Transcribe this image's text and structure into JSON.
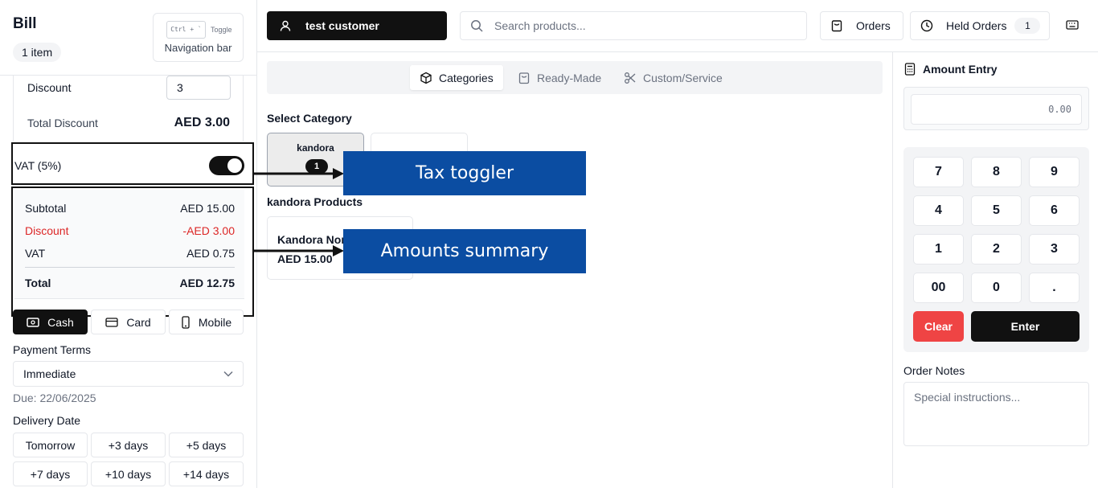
{
  "bill": {
    "title": "Bill",
    "item_count": "1 item",
    "nav_toggle": {
      "shortcut": "Ctrl + `",
      "word": "Toggle",
      "label": "Navigation bar"
    },
    "discount_label": "Discount",
    "discount_value": "3",
    "total_discount_label": "Total Discount",
    "total_discount_value": "AED 3.00",
    "vat_label": "VAT (5%)",
    "vat_enabled": true,
    "summary": {
      "subtotal_label": "Subtotal",
      "subtotal_value": "AED 15.00",
      "discount_label": "Discount",
      "discount_value": "-AED 3.00",
      "vat_label": "VAT",
      "vat_value": "AED 0.75",
      "total_label": "Total",
      "total_value": "AED 12.75"
    },
    "payment_methods": [
      "Cash",
      "Card",
      "Mobile"
    ],
    "selected_payment": "Cash",
    "payment_terms_label": "Payment Terms",
    "payment_terms_value": "Immediate",
    "due_text": "Due: 22/06/2025",
    "delivery_label": "Delivery Date",
    "delivery_options": [
      "Tomorrow",
      "+3 days",
      "+5 days",
      "+7 days",
      "+10 days",
      "+14 days"
    ]
  },
  "topbar": {
    "customer": "test customer",
    "search_placeholder": "Search products...",
    "orders_label": "Orders",
    "held_orders_label": "Held Orders",
    "held_orders_count": "1"
  },
  "main": {
    "tabs": [
      {
        "label": "Categories",
        "icon": "box-icon",
        "active": true
      },
      {
        "label": "Ready-Made",
        "icon": "bag-icon",
        "active": false
      },
      {
        "label": "Custom/Service",
        "icon": "scissors-icon",
        "active": false
      }
    ],
    "select_category_label": "Select Category",
    "categories": [
      {
        "name": "kandora",
        "count": "1"
      }
    ],
    "products_title": "kandora Products",
    "products": [
      {
        "name": "Kandora Normal",
        "price": "AED 15.00"
      }
    ]
  },
  "annotations": {
    "tax": "Tax toggler",
    "summary": "Amounts summary"
  },
  "amount_entry": {
    "title": "Amount Entry",
    "value": "0.00",
    "keys": [
      "7",
      "8",
      "9",
      "4",
      "5",
      "6",
      "1",
      "2",
      "3",
      "00",
      "0",
      "."
    ],
    "clear_label": "Clear",
    "enter_label": "Enter",
    "notes_label": "Order Notes",
    "notes_placeholder": "Special instructions..."
  },
  "colors": {
    "accent": "#111111",
    "danger": "#ef4444",
    "annotation": "#0b4da2"
  }
}
